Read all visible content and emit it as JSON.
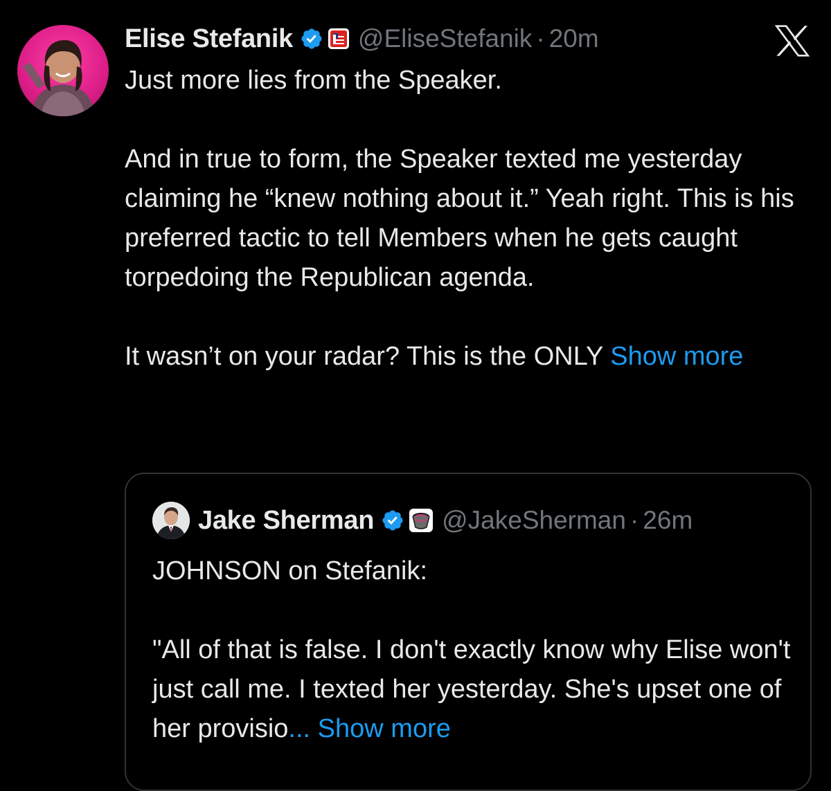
{
  "tweet": {
    "author_name": "Elise Stefanik",
    "handle": "@EliseStefanik",
    "separator": "·",
    "time": "20m",
    "avatar_icon": "user-avatar-photo",
    "verified_icon": "verified-badge-icon",
    "affiliate_icon": "flag-badge-icon",
    "paragraphs": [
      "Just more lies from the Speaker.",
      "And in true to form, the Speaker texted me yesterday claiming he “knew nothing about it.” Yeah right. This is his preferred tactic to tell Members when he gets caught torpedoing the Republican agenda.",
      "It wasn’t on your radar? This is the ONLY "
    ],
    "show_more": "Show more"
  },
  "platform": {
    "logo_icon": "x-logo-icon"
  },
  "quote": {
    "author_name": "Jake Sherman",
    "handle": "@JakeSherman",
    "separator": "·",
    "time": "26m",
    "paragraphs": [
      "JOHNSON on Stefanik:",
      "\"All of that is false. I don't exactly know why Elise won't just call me. I texted her yesterday. She's upset one of her provisio"
    ],
    "ellipsis": "...",
    "show_more": "Show more"
  },
  "colors": {
    "background": "#000000",
    "text": "#e7e9ea",
    "muted": "#71767b",
    "link": "#1d9bf0",
    "verified": "#1d9bf0",
    "border": "#2f3336"
  }
}
